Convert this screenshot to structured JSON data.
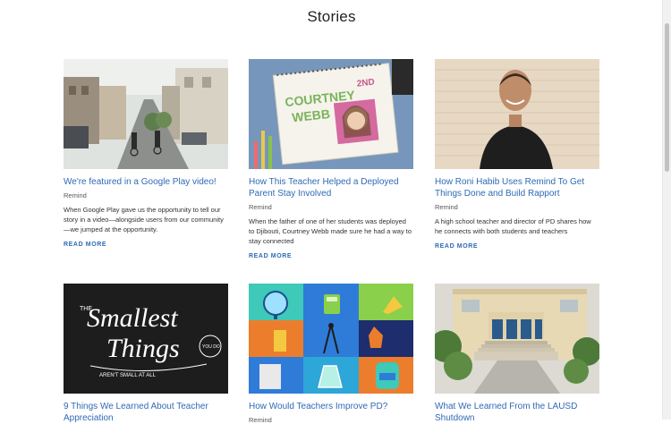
{
  "page": {
    "title": "Stories"
  },
  "cards": [
    {
      "title": "We're featured in a Google Play video!",
      "author": "Remind",
      "excerpt": "When Google Play gave us the opportunity to tell our story in a video—alongside users from our community—we jumped at the opportunity.",
      "read_more": "READ MORE"
    },
    {
      "title": "How This Teacher Helped a Deployed Parent Stay Involved",
      "author": "Remind",
      "excerpt": "When the father of one of her students was deployed to Djibouti, Courtney Webb made sure he had a way to stay connected",
      "read_more": "READ MORE"
    },
    {
      "title": "How Roni Habib Uses Remind To Get Things Done and Build Rapport",
      "author": "Remind",
      "excerpt": "A high school teacher and director of PD shares how he connects with both students and teachers",
      "read_more": "READ MORE"
    },
    {
      "title": "9 Things We Learned About Teacher Appreciation",
      "author": "",
      "excerpt": "",
      "read_more": ""
    },
    {
      "title": "How Would Teachers Improve PD?",
      "author": "Remind",
      "excerpt": "",
      "read_more": ""
    },
    {
      "title": "What We Learned From the LAUSD Shutdown",
      "author": "",
      "excerpt": "",
      "read_more": ""
    }
  ],
  "images": {
    "notebook_text_1": "COURTNEY",
    "notebook_text_2": "WEBB",
    "notebook_text_3": "2ND",
    "typo_line_1": "THE",
    "typo_line_2": "Smallest",
    "typo_line_3": "Things",
    "typo_line_4": "YOU DO",
    "typo_line_5": "AREN'T SMALL AT ALL"
  },
  "colors": {
    "link": "#2f6ab5",
    "title": "#222222",
    "body_text": "#333333"
  }
}
